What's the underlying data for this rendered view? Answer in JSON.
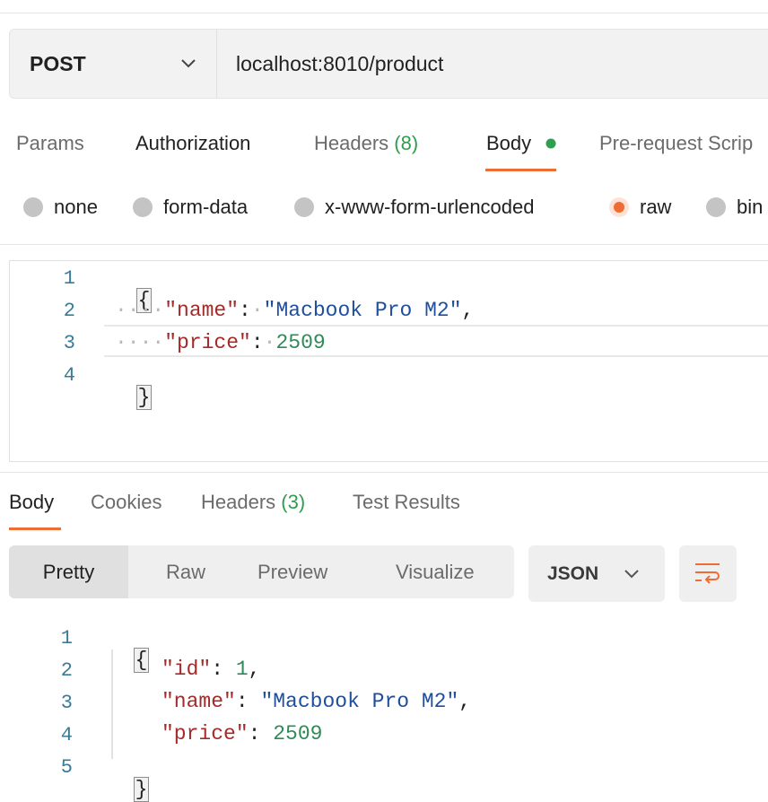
{
  "request": {
    "method": "POST",
    "url": "localhost:8010/product"
  },
  "request_tabs": [
    {
      "label": "Params"
    },
    {
      "label": "Authorization"
    },
    {
      "label": "Headers",
      "count": "(8)"
    },
    {
      "label": "Body"
    },
    {
      "label": "Pre-request Scrip"
    }
  ],
  "body_types": [
    "none",
    "form-data",
    "x-www-form-urlencoded",
    "raw",
    "bin"
  ],
  "body_type_selected": "raw",
  "request_body": {
    "line_numbers": [
      "1",
      "2",
      "3",
      "4"
    ],
    "open_brace": "{",
    "close_brace": "}",
    "name_key": "\"name\"",
    "name_value": "\"Macbook Pro M2\"",
    "price_key": "\"price\"",
    "price_value": "2509",
    "colon": ":",
    "comma": ","
  },
  "response_tabs": [
    {
      "label": "Body"
    },
    {
      "label": "Cookies"
    },
    {
      "label": "Headers",
      "count": "(3)"
    },
    {
      "label": "Test Results"
    }
  ],
  "response_views": [
    "Pretty",
    "Raw",
    "Preview",
    "Visualize"
  ],
  "response_format": "JSON",
  "response_body": {
    "line_numbers": [
      "1",
      "2",
      "3",
      "4",
      "5"
    ],
    "open_brace": "{",
    "close_brace": "}",
    "id_key": "\"id\"",
    "id_value": "1",
    "name_key": "\"name\"",
    "name_value": "\"Macbook Pro M2\"",
    "price_key": "\"price\"",
    "price_value": "2509",
    "colon": ":",
    "comma": ","
  },
  "colors": {
    "accent": "#ef6c35",
    "status_dot": "#2e9e4f",
    "count_green": "#2e9e4f"
  },
  "icons": [
    "chevron-down-icon",
    "status-dot-icon",
    "wrap-lines-icon"
  ]
}
